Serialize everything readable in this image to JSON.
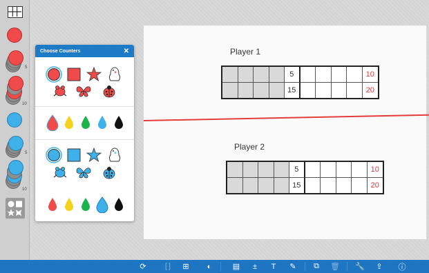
{
  "popup": {
    "title": "Choose Counters",
    "close_glyph": "✕",
    "red_set": {
      "shapes": [
        "circle",
        "square",
        "star",
        "penguin"
      ],
      "animals": [
        "frog",
        "butterfly",
        "ladybird"
      ],
      "drops": [
        "red",
        "yellow",
        "green",
        "blue",
        "black"
      ]
    },
    "blue_set": {
      "shapes": [
        "circle",
        "square",
        "star",
        "penguin"
      ],
      "animals": [
        "frog",
        "butterfly",
        "ladybird"
      ],
      "drops": [
        "red",
        "yellow",
        "green",
        "blue",
        "black"
      ]
    }
  },
  "sidebar": {
    "tools": [
      {
        "icon": "grid-icon"
      },
      {
        "icon": "red-counter-icon"
      },
      {
        "icon": "red-stack-5-icon",
        "count": "5"
      },
      {
        "icon": "red-stack-10-icon",
        "count": "10"
      },
      {
        "icon": "blue-counter-icon"
      },
      {
        "icon": "blue-stack-5-icon",
        "count": "5"
      },
      {
        "icon": "blue-stack-10-icon",
        "count": "10"
      },
      {
        "icon": "shapes-icon"
      }
    ]
  },
  "board": {
    "player1": {
      "label": "Player 1",
      "row1": [
        "",
        "",
        "",
        "",
        "5",
        "",
        "",
        "",
        "",
        "10"
      ],
      "row2": [
        "",
        "",
        "",
        "",
        "15",
        "",
        "",
        "",
        "",
        "20"
      ]
    },
    "player2": {
      "label": "Player 2",
      "row1": [
        "",
        "",
        "",
        "",
        "5",
        "",
        "",
        "",
        "",
        "10"
      ],
      "row2": [
        "",
        "",
        "",
        "",
        "15",
        "",
        "",
        "",
        "",
        "20"
      ]
    }
  },
  "toolbar": {
    "buttons": [
      {
        "icon": "refresh-icon",
        "glyph": "⟳"
      },
      {
        "icon": "number-bracket-icon",
        "glyph": "⁅⁆"
      },
      {
        "icon": "number-box-icon",
        "glyph": "⊞"
      },
      {
        "icon": "fill-icon",
        "glyph": "◐"
      },
      {
        "icon": "window-icon",
        "glyph": "▤"
      },
      {
        "icon": "calculator-icon",
        "glyph": "±"
      },
      {
        "icon": "text-icon",
        "glyph": "T"
      },
      {
        "icon": "pen-icon",
        "glyph": "✎"
      },
      {
        "icon": "duplicate-icon",
        "glyph": "⧉"
      },
      {
        "icon": "trash-icon",
        "glyph": "🗑"
      },
      {
        "icon": "wrench-icon",
        "glyph": "🔧"
      },
      {
        "icon": "share-icon",
        "glyph": "⇪"
      },
      {
        "icon": "info-icon",
        "glyph": "ⓘ"
      }
    ]
  },
  "colors": {
    "red": "#f04a4a",
    "blue": "#3fb0ea",
    "yellow": "#f5d21c",
    "green": "#1bb34c",
    "black": "#111111",
    "toolbar": "#1e76c2",
    "divider": "#e53b3b"
  }
}
